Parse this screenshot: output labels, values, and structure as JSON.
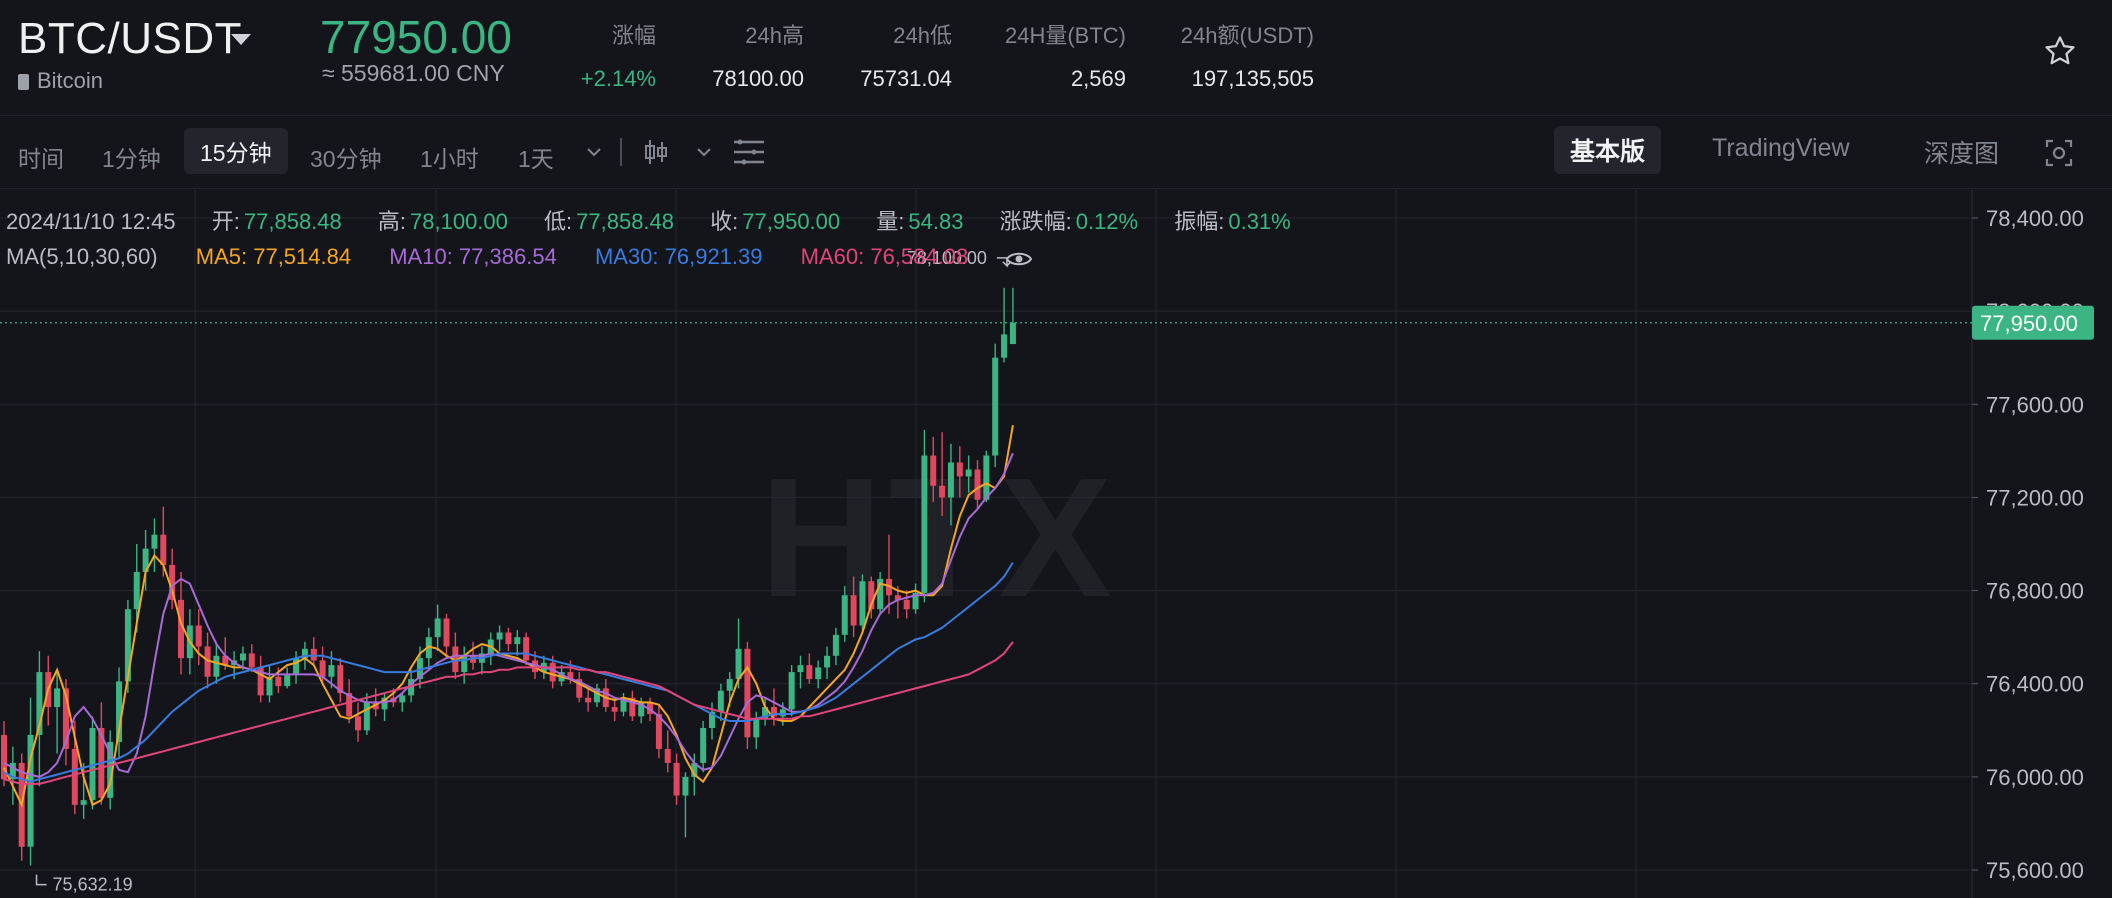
{
  "header": {
    "pair": "BTC/USDT",
    "coin": "Bitcoin",
    "price": "77950.00",
    "price_cny": "≈ 559681.00 CNY",
    "stats": [
      {
        "label": "涨幅",
        "value": "+2.14%",
        "color": "#3ab583"
      },
      {
        "label": "24h高",
        "value": "78100.00",
        "color": "#e6e8ea"
      },
      {
        "label": "24h低",
        "value": "75731.04",
        "color": "#e6e8ea"
      },
      {
        "label": "24H量(BTC)",
        "value": "2,569",
        "color": "#e6e8ea"
      },
      {
        "label": "24h额(USDT)",
        "value": "197,135,505",
        "color": "#e6e8ea"
      }
    ]
  },
  "toolbar": {
    "timeframes": [
      "时间",
      "1分钟",
      "15分钟",
      "30分钟",
      "1小时",
      "1天"
    ],
    "active_timeframe": "15分钟",
    "views": [
      "基本版",
      "TradingView",
      "深度图"
    ],
    "active_view": "基本版"
  },
  "ohlc": {
    "time": "2024/11/10 12:45",
    "open_label": "开:",
    "open": "77,858.48",
    "high_label": "高:",
    "high": "78,100.00",
    "low_label": "低:",
    "low": "77,858.48",
    "close_label": "收:",
    "close": "77,950.00",
    "vol_label": "量:",
    "vol": "54.83",
    "chg_label": "涨跌幅:",
    "chg": "0.12%",
    "amp_label": "振幅:",
    "amp": "0.31%"
  },
  "ma": {
    "label": "MA(5,10,30,60)",
    "ma5": "MA5: 77,514.84",
    "ma10": "MA10: 77,386.54",
    "ma30": "MA30: 76,921.39",
    "ma60": "MA60: 76,584.08"
  },
  "watermark": "HTX",
  "colors": {
    "up": "#3ab583",
    "down": "#e0485f",
    "ma5": "#f5a623",
    "ma10": "#a76ad6",
    "ma30": "#3a7be0",
    "ma60": "#e0457a",
    "grid": "#26282f",
    "current_price_bg": "#3ab583"
  },
  "chart_data": {
    "type": "candlestick",
    "title": "BTC/USDT 15分钟",
    "ylim": [
      75480,
      78520
    ],
    "y_ticks": [
      75600,
      76000,
      76400,
      76800,
      77200,
      77600,
      78000,
      78400
    ],
    "y_tick_labels": [
      "75,600.00",
      "76,000.00",
      "76,400.00",
      "76,800.00",
      "77,200.00",
      "77,600.00",
      "78,000.00",
      "78,400.00"
    ],
    "current_price": 77950,
    "current_price_label": "77,950.00",
    "max_label": "78,100.00",
    "min_label": "75,632.19",
    "series": [
      {
        "name": "MA5",
        "values": [
          76040,
          75960,
          75880,
          76080,
          76220,
          76380,
          76460,
          76350,
          76170,
          76000,
          75880,
          75900,
          75970,
          76200,
          76430,
          76660,
          76880,
          76950,
          76910,
          76800,
          76660,
          76580,
          76530,
          76500,
          76490,
          76480,
          76470,
          76470,
          76460,
          76440,
          76420,
          76450,
          76480,
          76490,
          76510,
          76480,
          76400,
          76330,
          76260,
          76250,
          76270,
          76290,
          76310,
          76330,
          76360,
          76400,
          76470,
          76530,
          76560,
          76550,
          76520,
          76500,
          76520,
          76550,
          76570,
          76560,
          76530,
          76520,
          76510,
          76490,
          76470,
          76450,
          76440,
          76430,
          76420,
          76400,
          76380,
          76360,
          76340,
          76330,
          76340,
          76330,
          76320,
          76320,
          76310,
          76260,
          76180,
          76080,
          76010,
          75980,
          76040,
          76180,
          76320,
          76420,
          76470,
          76400,
          76300,
          76250,
          76240,
          76240,
          76260,
          76300,
          76340,
          76380,
          76420,
          76460,
          76530,
          76620,
          76740,
          76830,
          76820,
          76800,
          76790,
          76800,
          76780,
          76780,
          76820,
          76980,
          77120,
          77210,
          77240,
          77260,
          77240,
          77290,
          77510
        ]
      },
      {
        "name": "MA10",
        "values": [
          76060,
          76040,
          76020,
          76010,
          76000,
          76020,
          76060,
          76150,
          76260,
          76300,
          76250,
          76180,
          76100,
          76030,
          76020,
          76100,
          76260,
          76490,
          76700,
          76820,
          76850,
          76830,
          76740,
          76650,
          76570,
          76520,
          76490,
          76470,
          76460,
          76450,
          76440,
          76440,
          76440,
          76440,
          76440,
          76440,
          76430,
          76400,
          76370,
          76350,
          76330,
          76320,
          76320,
          76320,
          76330,
          76360,
          76400,
          76430,
          76460,
          76490,
          76510,
          76520,
          76520,
          76520,
          76520,
          76530,
          76520,
          76510,
          76500,
          76490,
          76480,
          76470,
          76460,
          76440,
          76420,
          76410,
          76390,
          76370,
          76360,
          76340,
          76330,
          76320,
          76310,
          76290,
          76260,
          76220,
          76170,
          76110,
          76060,
          76030,
          76040,
          76090,
          76170,
          76250,
          76320,
          76350,
          76340,
          76320,
          76300,
          76280,
          76280,
          76290,
          76310,
          76340,
          76370,
          76410,
          76470,
          76540,
          76630,
          76700,
          76740,
          76760,
          76770,
          76780,
          76780,
          76790,
          76830,
          76930,
          77030,
          77110,
          77150,
          77200,
          77240,
          77300,
          77390
        ]
      },
      {
        "name": "MA30",
        "values": [
          76020,
          76000,
          75990,
          75980,
          75990,
          76000,
          76010,
          76020,
          76030,
          76040,
          76050,
          76060,
          76070,
          76080,
          76100,
          76130,
          76160,
          76200,
          76240,
          76280,
          76310,
          76340,
          76370,
          76390,
          76410,
          76430,
          76440,
          76450,
          76460,
          76470,
          76480,
          76490,
          76500,
          76510,
          76520,
          76520,
          76520,
          76510,
          76500,
          76490,
          76480,
          76470,
          76460,
          76450,
          76450,
          76450,
          76450,
          76460,
          76470,
          76480,
          76490,
          76500,
          76500,
          76510,
          76510,
          76520,
          76530,
          76530,
          76530,
          76530,
          76520,
          76510,
          76500,
          76490,
          76480,
          76470,
          76460,
          76450,
          76440,
          76430,
          76420,
          76410,
          76400,
          76390,
          76380,
          76370,
          76350,
          76330,
          76310,
          76290,
          76270,
          76250,
          76240,
          76240,
          76240,
          76250,
          76260,
          76270,
          76270,
          76270,
          76280,
          76290,
          76300,
          76320,
          76340,
          76370,
          76400,
          76430,
          76460,
          76490,
          76520,
          76550,
          76570,
          76590,
          76600,
          76620,
          76640,
          76670,
          76700,
          76730,
          76760,
          76790,
          76820,
          76860,
          76920
        ]
      },
      {
        "name": "MA60",
        "values": [
          75990,
          75980,
          75970,
          75970,
          75970,
          75980,
          75990,
          76000,
          76010,
          76020,
          76030,
          76040,
          76050,
          76060,
          76070,
          76080,
          76090,
          76100,
          76110,
          76120,
          76130,
          76140,
          76150,
          76160,
          76170,
          76180,
          76190,
          76200,
          76210,
          76220,
          76230,
          76240,
          76250,
          76260,
          76270,
          76280,
          76290,
          76300,
          76310,
          76320,
          76330,
          76340,
          76350,
          76360,
          76370,
          76380,
          76390,
          76400,
          76410,
          76420,
          76430,
          76430,
          76440,
          76440,
          76450,
          76450,
          76460,
          76460,
          76470,
          76470,
          76470,
          76470,
          76470,
          76470,
          76470,
          76460,
          76460,
          76450,
          76450,
          76440,
          76430,
          76420,
          76410,
          76400,
          76390,
          76370,
          76350,
          76330,
          76310,
          76300,
          76290,
          76280,
          76270,
          76260,
          76250,
          76250,
          76250,
          76250,
          76250,
          76250,
          76260,
          76260,
          76270,
          76280,
          76290,
          76300,
          76310,
          76320,
          76330,
          76340,
          76350,
          76360,
          76370,
          76380,
          76390,
          76400,
          76410,
          76420,
          76430,
          76440,
          76460,
          76480,
          76500,
          76530,
          76580
        ]
      }
    ],
    "candles": [
      [
        76180,
        76240,
        75960,
        75990
      ],
      [
        75990,
        76130,
        75880,
        76060
      ],
      [
        76060,
        76100,
        75640,
        75700
      ],
      [
        75700,
        76340,
        75620,
        76180
      ],
      [
        76180,
        76540,
        75960,
        76450
      ],
      [
        76450,
        76520,
        76220,
        76300
      ],
      [
        76300,
        76460,
        76100,
        76380
      ],
      [
        76380,
        76420,
        76050,
        76120
      ],
      [
        76120,
        76240,
        75840,
        75880
      ],
      [
        75880,
        76060,
        75820,
        75900
      ],
      [
        75900,
        76260,
        75860,
        76210
      ],
      [
        76210,
        76320,
        75880,
        75910
      ],
      [
        75910,
        76200,
        75860,
        76150
      ],
      [
        76150,
        76470,
        76080,
        76410
      ],
      [
        76410,
        76760,
        76360,
        76720
      ],
      [
        76720,
        77000,
        76620,
        76880
      ],
      [
        76880,
        77060,
        76800,
        76980
      ],
      [
        76980,
        77110,
        76880,
        77040
      ],
      [
        77040,
        77160,
        76860,
        76910
      ],
      [
        76910,
        76980,
        76720,
        76760
      ],
      [
        76760,
        76880,
        76440,
        76510
      ],
      [
        76510,
        76720,
        76440,
        76650
      ],
      [
        76650,
        76720,
        76480,
        76560
      ],
      [
        76560,
        76620,
        76380,
        76430
      ],
      [
        76430,
        76580,
        76400,
        76520
      ],
      [
        76520,
        76600,
        76460,
        76480
      ],
      [
        76480,
        76540,
        76420,
        76500
      ],
      [
        76500,
        76560,
        76460,
        76530
      ],
      [
        76530,
        76570,
        76450,
        76470
      ],
      [
        76470,
        76520,
        76320,
        76350
      ],
      [
        76350,
        76480,
        76320,
        76430
      ],
      [
        76430,
        76470,
        76360,
        76390
      ],
      [
        76390,
        76470,
        76380,
        76440
      ],
      [
        76440,
        76540,
        76400,
        76510
      ],
      [
        76510,
        76580,
        76460,
        76550
      ],
      [
        76550,
        76600,
        76480,
        76500
      ],
      [
        76500,
        76560,
        76400,
        76430
      ],
      [
        76430,
        76540,
        76380,
        76480
      ],
      [
        76480,
        76510,
        76320,
        76360
      ],
      [
        76360,
        76420,
        76230,
        76260
      ],
      [
        76260,
        76320,
        76150,
        76200
      ],
      [
        76200,
        76360,
        76180,
        76320
      ],
      [
        76320,
        76380,
        76260,
        76290
      ],
      [
        76290,
        76360,
        76240,
        76340
      ],
      [
        76340,
        76380,
        76300,
        76320
      ],
      [
        76320,
        76360,
        76280,
        76350
      ],
      [
        76350,
        76460,
        76320,
        76420
      ],
      [
        76420,
        76560,
        76380,
        76510
      ],
      [
        76510,
        76640,
        76460,
        76600
      ],
      [
        76600,
        76740,
        76540,
        76680
      ],
      [
        76680,
        76700,
        76520,
        76560
      ],
      [
        76560,
        76620,
        76420,
        76450
      ],
      [
        76450,
        76560,
        76400,
        76520
      ],
      [
        76520,
        76580,
        76460,
        76490
      ],
      [
        76490,
        76560,
        76440,
        76530
      ],
      [
        76530,
        76620,
        76480,
        76590
      ],
      [
        76590,
        76650,
        76540,
        76620
      ],
      [
        76620,
        76640,
        76540,
        76570
      ],
      [
        76570,
        76630,
        76520,
        76600
      ],
      [
        76600,
        76620,
        76480,
        76500
      ],
      [
        76500,
        76540,
        76420,
        76450
      ],
      [
        76450,
        76520,
        76420,
        76490
      ],
      [
        76490,
        76520,
        76380,
        76410
      ],
      [
        76410,
        76480,
        76390,
        76450
      ],
      [
        76450,
        76500,
        76400,
        76420
      ],
      [
        76420,
        76450,
        76320,
        76340
      ],
      [
        76340,
        76380,
        76280,
        76320
      ],
      [
        76320,
        76400,
        76300,
        76380
      ],
      [
        76380,
        76420,
        76280,
        76300
      ],
      [
        76300,
        76340,
        76240,
        76280
      ],
      [
        76280,
        76360,
        76260,
        76340
      ],
      [
        76340,
        76370,
        76240,
        76260
      ],
      [
        76260,
        76340,
        76230,
        76320
      ],
      [
        76320,
        76340,
        76240,
        76270
      ],
      [
        76270,
        76310,
        76080,
        76120
      ],
      [
        76120,
        76200,
        76020,
        76060
      ],
      [
        76060,
        76100,
        75880,
        75920
      ],
      [
        75920,
        76020,
        75740,
        76000
      ],
      [
        76000,
        76100,
        75920,
        76060
      ],
      [
        76060,
        76240,
        76020,
        76210
      ],
      [
        76210,
        76320,
        76160,
        76280
      ],
      [
        76280,
        76400,
        76240,
        76370
      ],
      [
        76370,
        76450,
        76300,
        76420
      ],
      [
        76420,
        76680,
        76380,
        76550
      ],
      [
        76550,
        76580,
        76120,
        76170
      ],
      [
        76170,
        76280,
        76120,
        76250
      ],
      [
        76250,
        76340,
        76220,
        76300
      ],
      [
        76300,
        76380,
        76220,
        76260
      ],
      [
        76260,
        76320,
        76220,
        76290
      ],
      [
        76290,
        76480,
        76260,
        76450
      ],
      [
        76450,
        76520,
        76380,
        76480
      ],
      [
        76480,
        76530,
        76400,
        76420
      ],
      [
        76420,
        76500,
        76380,
        76470
      ],
      [
        76470,
        76560,
        76420,
        76520
      ],
      [
        76520,
        76640,
        76480,
        76610
      ],
      [
        76610,
        76820,
        76580,
        76780
      ],
      [
        76780,
        76860,
        76600,
        76650
      ],
      [
        76650,
        76870,
        76620,
        76840
      ],
      [
        76840,
        76860,
        76680,
        76720
      ],
      [
        76720,
        76880,
        76700,
        76850
      ],
      [
        76850,
        77040,
        76700,
        76780
      ],
      [
        76780,
        76820,
        76680,
        76760
      ],
      [
        76760,
        76800,
        76680,
        76720
      ],
      [
        76720,
        76830,
        76700,
        76790
      ],
      [
        76790,
        77490,
        76750,
        77380
      ],
      [
        77380,
        77460,
        77180,
        77250
      ],
      [
        77250,
        77480,
        77120,
        77200
      ],
      [
        77200,
        77430,
        77080,
        77350
      ],
      [
        77350,
        77420,
        77200,
        77290
      ],
      [
        77290,
        77380,
        77220,
        77320
      ],
      [
        77320,
        77360,
        77150,
        77190
      ],
      [
        77190,
        77400,
        77180,
        77380
      ],
      [
        77380,
        77860,
        77330,
        77800
      ],
      [
        77800,
        78100,
        77780,
        77900
      ],
      [
        77858.48,
        78100,
        77858.48,
        77950
      ]
    ]
  }
}
